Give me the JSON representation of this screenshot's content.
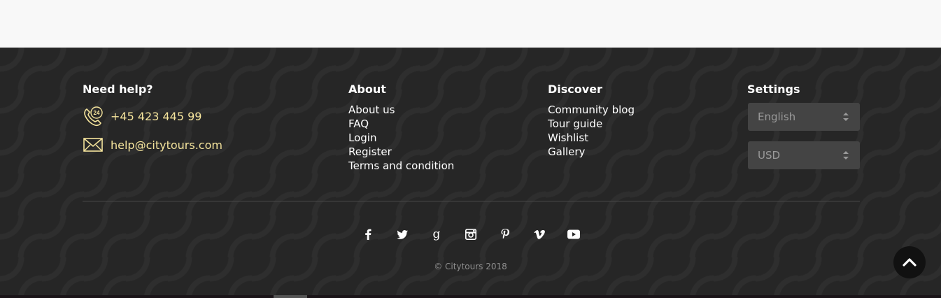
{
  "help": {
    "title": "Need help?",
    "phone": "+45 423 445 99",
    "email": "help@citytours.com",
    "phone_icon": "phone-24h-icon",
    "email_icon": "envelope-icon"
  },
  "about": {
    "title": "About",
    "links": [
      "About us",
      "FAQ",
      "Login",
      "Register",
      "Terms and condition"
    ]
  },
  "discover": {
    "title": "Discover",
    "links": [
      "Community blog",
      "Tour guide",
      "Wishlist",
      "Gallery"
    ]
  },
  "settings": {
    "title": "Settings",
    "language": "English",
    "currency": "USD"
  },
  "social": [
    "facebook-icon",
    "twitter-icon",
    "google-icon",
    "instagram-icon",
    "pinterest-icon",
    "vimeo-icon",
    "youtube-icon"
  ],
  "copyright": "© Citytours 2018",
  "colors": {
    "footer_bg": "#262626",
    "accent": "#f5e49c",
    "select_bg": "#444444"
  }
}
